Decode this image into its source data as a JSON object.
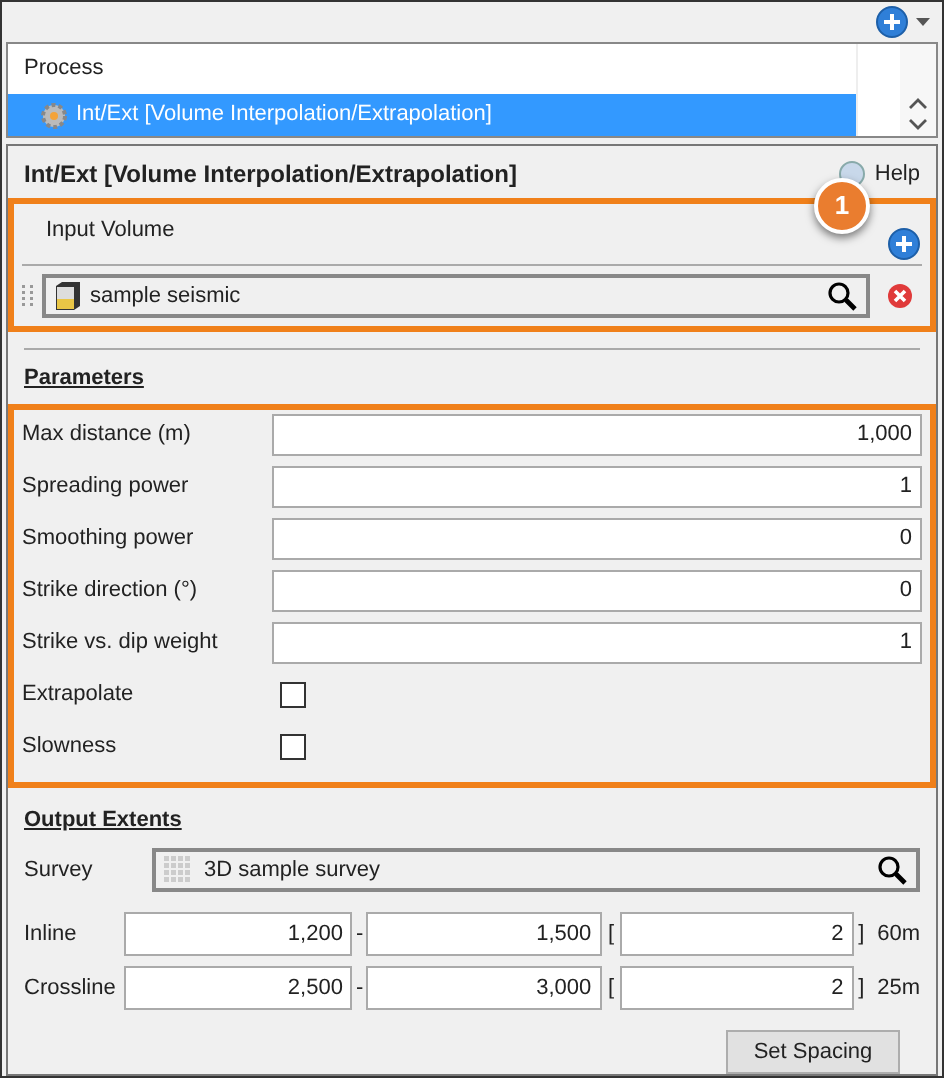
{
  "process_list": {
    "header": "Process",
    "items": [
      {
        "label": "Int/Ext [Volume Interpolation/Extrapolation]",
        "selected": true
      }
    ]
  },
  "panel": {
    "title": "Int/Ext [Volume Interpolation/Extrapolation]",
    "help": "Help"
  },
  "callout": {
    "number": "1"
  },
  "input_volume": {
    "label": "Input Volume",
    "value": "sample seismic"
  },
  "parameters": {
    "heading": "Parameters",
    "fields": [
      {
        "kind": "number",
        "label": "Max distance (m)",
        "value": "1,000"
      },
      {
        "kind": "number",
        "label": "Spreading power",
        "value": "1"
      },
      {
        "kind": "number",
        "label": "Smoothing power",
        "value": "0"
      },
      {
        "kind": "number",
        "label": "Strike direction (°)",
        "value": "0"
      },
      {
        "kind": "number",
        "label": "Strike vs. dip weight",
        "value": "1"
      },
      {
        "kind": "checkbox",
        "label": "Extrapolate",
        "checked": false
      },
      {
        "kind": "checkbox",
        "label": "Slowness",
        "checked": false
      }
    ]
  },
  "output_extents": {
    "heading": "Output Extents",
    "survey_label": "Survey",
    "survey": "3D sample survey",
    "dash": "-",
    "open_bracket": "[",
    "close_bracket": "]",
    "rows": [
      {
        "label": "Inline",
        "start": "1,200",
        "end": "1,500",
        "step": "2",
        "spacing": "60m"
      },
      {
        "label": "Crossline",
        "start": "2,500",
        "end": "3,000",
        "step": "2",
        "spacing": "25m"
      }
    ],
    "button": "Set Spacing"
  }
}
